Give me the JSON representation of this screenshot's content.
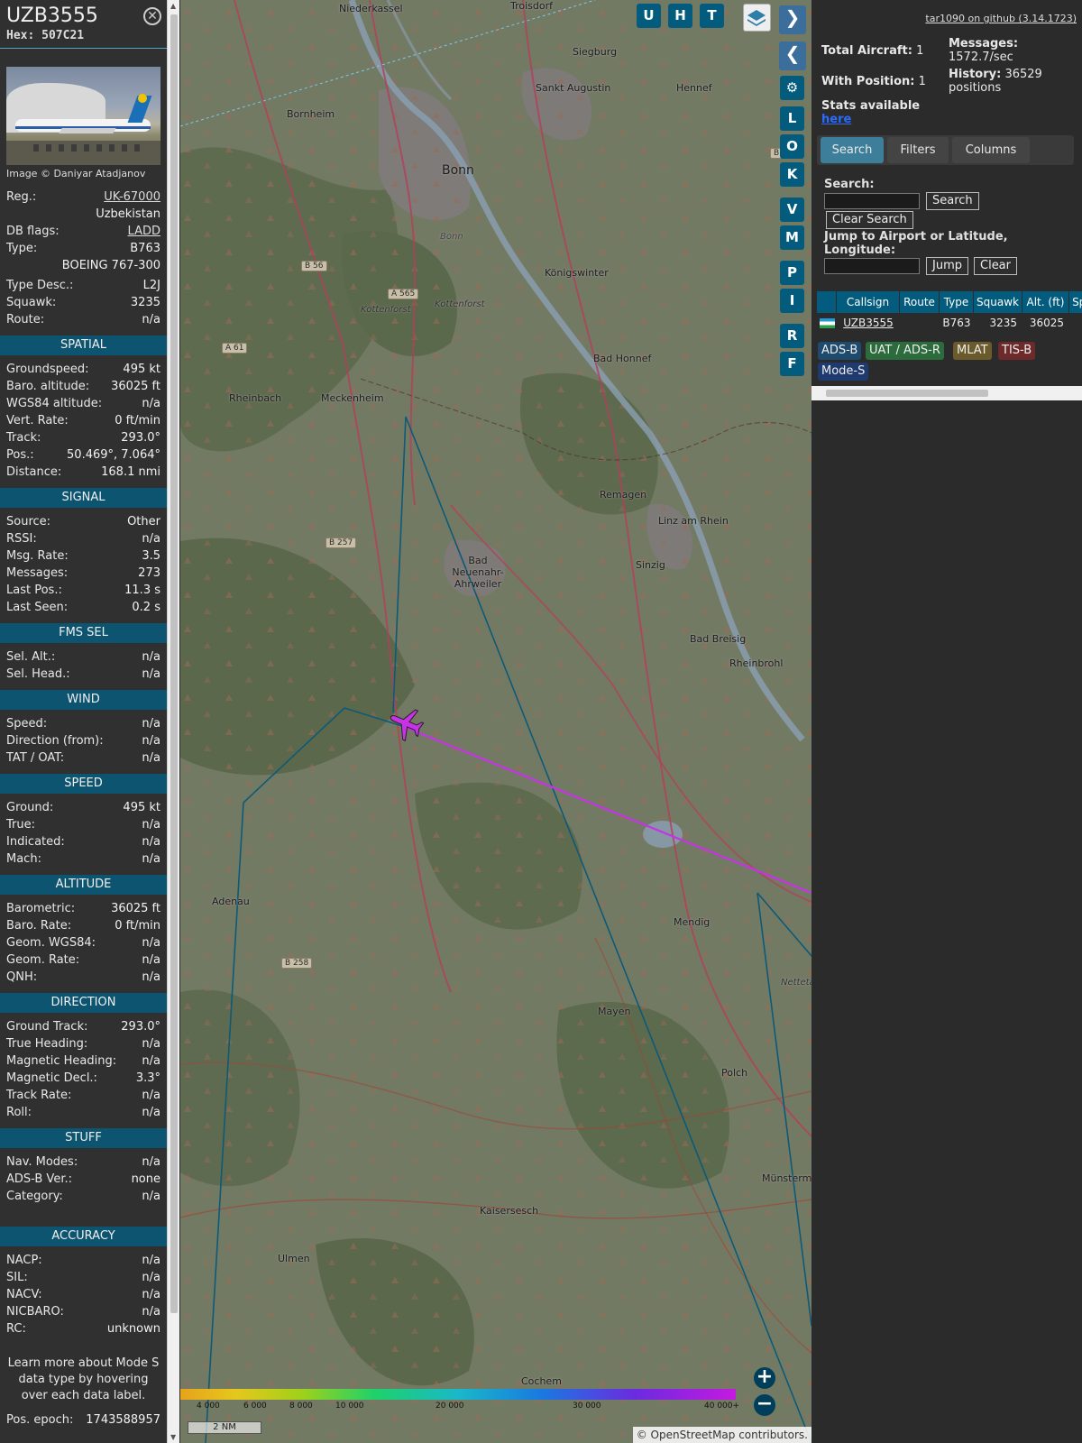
{
  "aircraft": {
    "callsign": "UZB3555",
    "hex_label": "Hex: 507C21",
    "photo_credit": "Image © Daniyar Atadjanov",
    "reg_label": "Reg.:",
    "reg": "UK-67000",
    "country": "Uzbekistan",
    "dbflags_label": "DB flags:",
    "dbflags": "LADD",
    "type_label": "Type:",
    "type": "B763",
    "type_full": "BOEING 767-300",
    "typedesc_label": "Type Desc.:",
    "typedesc": "L2J",
    "squawk_label": "Squawk:",
    "squawk": "3235",
    "route_label": "Route:",
    "route": "n/a"
  },
  "sections": {
    "spatial": "SPATIAL",
    "signal": "SIGNAL",
    "fms": "FMS SEL",
    "wind": "WIND",
    "speed": "SPEED",
    "altitude": "ALTITUDE",
    "direction": "DIRECTION",
    "stuff": "STUFF",
    "accuracy": "ACCURACY"
  },
  "spatial": [
    {
      "label": "Groundspeed:",
      "value": "495 kt"
    },
    {
      "label": "Baro. altitude:",
      "value": "36025 ft"
    },
    {
      "label": "WGS84 altitude:",
      "value": "n/a"
    },
    {
      "label": "Vert. Rate:",
      "value": "0 ft/min"
    },
    {
      "label": "Track:",
      "value": "293.0°"
    },
    {
      "label": "Pos.:",
      "value": "50.469°, 7.064°"
    },
    {
      "label": "Distance:",
      "value": "168.1 nmi"
    }
  ],
  "signal": [
    {
      "label": "Source:",
      "value": "Other"
    },
    {
      "label": "RSSI:",
      "value": "n/a"
    },
    {
      "label": "Msg. Rate:",
      "value": "3.5"
    },
    {
      "label": "Messages:",
      "value": "273"
    },
    {
      "label": "Last Pos.:",
      "value": "11.3 s"
    },
    {
      "label": "Last Seen:",
      "value": "0.2 s"
    }
  ],
  "fms": [
    {
      "label": "Sel. Alt.:",
      "value": "n/a"
    },
    {
      "label": "Sel. Head.:",
      "value": "n/a"
    }
  ],
  "wind": [
    {
      "label": "Speed:",
      "value": "n/a"
    },
    {
      "label": "Direction (from):",
      "value": "n/a"
    },
    {
      "label": "TAT / OAT:",
      "value": "n/a"
    }
  ],
  "speed": [
    {
      "label": "Ground:",
      "value": "495 kt"
    },
    {
      "label": "True:",
      "value": "n/a"
    },
    {
      "label": "Indicated:",
      "value": "n/a"
    },
    {
      "label": "Mach:",
      "value": "n/a"
    }
  ],
  "altitude": [
    {
      "label": "Barometric:",
      "value": "36025 ft"
    },
    {
      "label": "Baro. Rate:",
      "value": "0 ft/min"
    },
    {
      "label": "Geom. WGS84:",
      "value": "n/a"
    },
    {
      "label": "Geom. Rate:",
      "value": "n/a"
    },
    {
      "label": "QNH:",
      "value": "n/a"
    }
  ],
  "direction": [
    {
      "label": "Ground Track:",
      "value": "293.0°"
    },
    {
      "label": "True Heading:",
      "value": "n/a"
    },
    {
      "label": "Magnetic Heading:",
      "value": "n/a"
    },
    {
      "label": "Magnetic Decl.:",
      "value": "3.3°"
    },
    {
      "label": "Track Rate:",
      "value": "n/a"
    },
    {
      "label": "Roll:",
      "value": "n/a"
    }
  ],
  "stuff": [
    {
      "label": "Nav. Modes:",
      "value": "n/a"
    },
    {
      "label": "ADS-B Ver.:",
      "value": "none"
    },
    {
      "label": "Category:",
      "value": "n/a"
    }
  ],
  "accuracy": [
    {
      "label": "NACP:",
      "value": "n/a"
    },
    {
      "label": "SIL:",
      "value": "n/a"
    },
    {
      "label": "NACV:",
      "value": "n/a"
    },
    {
      "label": "NICBARO:",
      "value": "n/a"
    },
    {
      "label": "RC:",
      "value": "unknown"
    }
  ],
  "learn_more": "Learn more about Mode S data type by hovering over each data label.",
  "pos_epoch": {
    "label": "Pos. epoch:",
    "value": "1743588957"
  },
  "map": {
    "buttons_top": [
      "U",
      "H",
      "T"
    ],
    "buttons_side": [
      "L",
      "O",
      "K",
      "V",
      "M",
      "P",
      "I",
      "R",
      "F"
    ],
    "towns": [
      "Niederkassel",
      "Troisdorf",
      "Siegburg",
      "Sankt Augustin",
      "Hennef",
      "Bornheim",
      "Bonn",
      "Königswinter",
      "Bad Honnef",
      "Rheinbach",
      "Meckenheim",
      "Remagen",
      "Linz am Rhein",
      "Bad Neuenahr-Ahrweiler",
      "Sinzig",
      "Bad Breisig",
      "Rheinbrohl",
      "Adenau",
      "Mendig",
      "Mayen",
      "Polch",
      "Münsterm",
      "Kaisersesch",
      "Ulmen",
      "Cochem",
      "Kottenforst",
      "Kottenforst",
      "Nettetal",
      "Bonn"
    ],
    "roads": [
      "B 56",
      "A 565",
      "A 61",
      "B 257",
      "B 258",
      "B"
    ],
    "scale": "2 NM",
    "color_keys": [
      "4 000",
      "6 000",
      "8 000",
      "10 000",
      "20 000",
      "30 000",
      "40 000+"
    ],
    "attribution": "© OpenStreetMap contributors.",
    "attribution_link": "OpenStreetMap"
  },
  "right": {
    "version": "tar1090 on github (3.14.1723)",
    "total_aircraft_label": "Total Aircraft:",
    "total_aircraft": "1",
    "with_position_label": "With Position:",
    "with_position": "1",
    "messages_label": "Messages:",
    "messages": "1572.7/sec",
    "history_label": "History:",
    "history": "36529 positions",
    "stats_label": "Stats available",
    "stats_link": "here",
    "tabs": [
      "Search",
      "Filters",
      "Columns"
    ],
    "search_label": "Search:",
    "search_button": "Search",
    "clear_search_button": "Clear Search",
    "jump_label": "Jump to Airport or Latitude, Longitude:",
    "jump_button": "Jump",
    "clear_button": "Clear",
    "columns": [
      "",
      "Callsign",
      "Route",
      "Type",
      "Squawk",
      "Alt. (ft)",
      "Spd"
    ],
    "row": {
      "callsign": "UZB3555",
      "route": "",
      "type": "B763",
      "squawk": "3235",
      "alt": "36025"
    },
    "badges": [
      "ADS-B",
      "UAT / ADS-R",
      "MLAT",
      "TIS-B",
      "Mode-S"
    ]
  },
  "colors": {
    "section_bg": "#0d5470",
    "button_bg": "#035c7e",
    "track": "#005f80",
    "selected_track": "#c832e6",
    "badge_adsb": "#1e4a6e",
    "badge_uat": "#2b6b3c",
    "badge_mlat": "#6b5a2b",
    "badge_tisb": "#6e2a2a",
    "badge_modes": "#1e3a6e"
  }
}
